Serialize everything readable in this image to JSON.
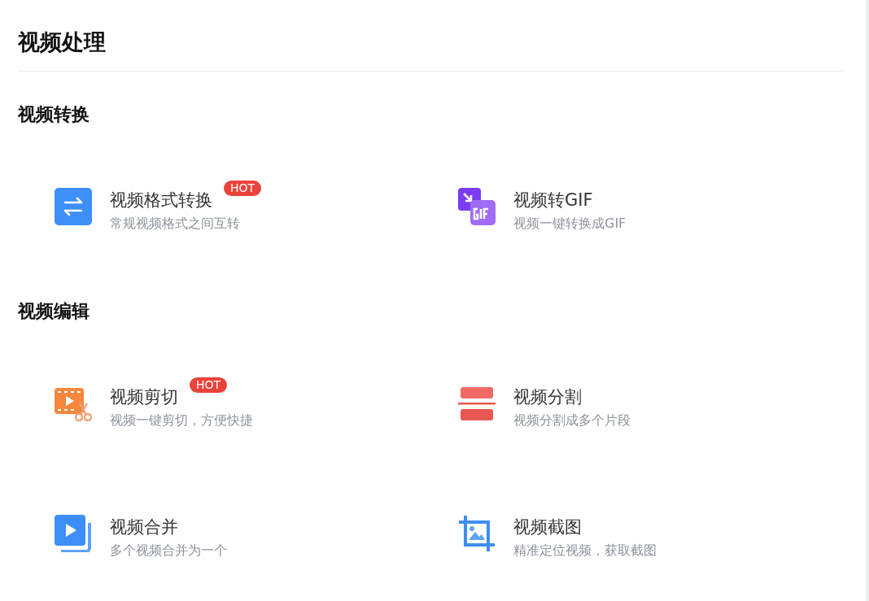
{
  "page_title": "视频处理",
  "sections": [
    {
      "heading": "视频转换",
      "items": [
        {
          "kind": "convert",
          "title": "视频格式转换",
          "badge": "HOT",
          "description": "常规视频格式之间互转"
        },
        {
          "kind": "gif",
          "title": "视频转GIF",
          "description": "视频一键转换成GIF"
        }
      ]
    },
    {
      "heading": "视频编辑",
      "items": [
        {
          "kind": "cut",
          "title": "视频剪切",
          "badge": "HOT",
          "description": "视频一键剪切，方便快捷"
        },
        {
          "kind": "split",
          "title": "视频分割",
          "description": "视频分割成多个片段"
        },
        {
          "kind": "merge",
          "title": "视频合并",
          "description": "多个视频合并为一个"
        },
        {
          "kind": "crop",
          "title": "视频截图",
          "description": "精准定位视频，获取截图"
        }
      ]
    }
  ]
}
